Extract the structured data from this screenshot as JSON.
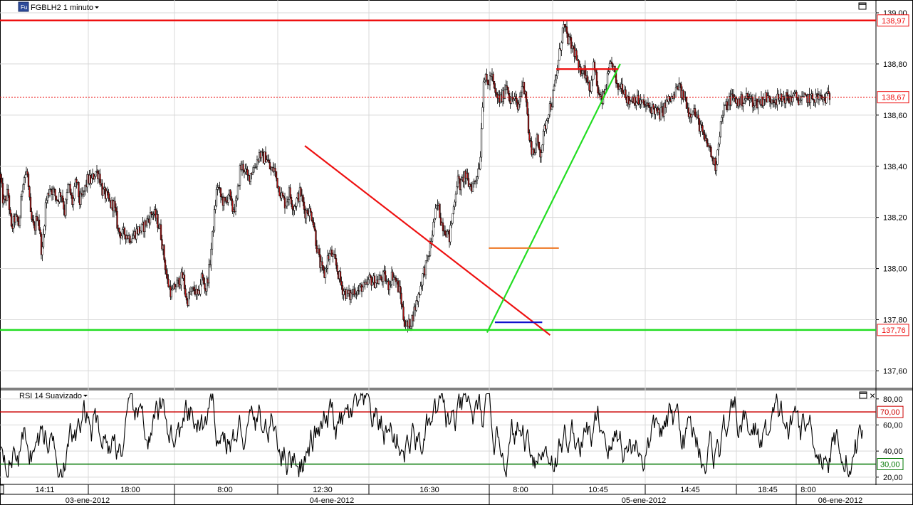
{
  "header": {
    "instrument_badge": "Fu",
    "title": "FGBLH2 1 minuto"
  },
  "rsi_panel": {
    "title": "RSI 14 Suavizado",
    "close_glyph": "×"
  },
  "colors": {
    "resistance": "#ee1111",
    "support": "#22dd22",
    "orange": "#ee7722",
    "blue": "#1111cc",
    "grid": "#d8d8d8",
    "candle_up": "#ffffff",
    "candle_down": "#aa1111",
    "rsi_upper": "#cc0000",
    "rsi_lower": "#007700"
  },
  "chart_data": [
    {
      "type": "candlestick",
      "title": "FGBLH2 1 minuto",
      "ylim": [
        137.54,
        139.0
      ],
      "y_ticks": [
        "137,60",
        "137,80",
        "138,00",
        "138,20",
        "138,40",
        "138,60",
        "138,80",
        "139,00"
      ],
      "y_tick_values": [
        137.6,
        137.8,
        138.0,
        138.2,
        138.4,
        138.6,
        138.8,
        139.0
      ],
      "time_ticks": [
        "14:11",
        "18:00",
        "8:00",
        "12:30",
        "16:30",
        "8:00",
        "10:45",
        "14:45",
        "18:45",
        "8:00"
      ],
      "date_labels": [
        "03-ene-2012",
        "04-ene-2012",
        "05-ene-2012",
        "06-ene-2012"
      ],
      "price_labels": [
        {
          "text": "138,97",
          "value": 138.97,
          "color": "resistance"
        },
        {
          "text": "138,67",
          "value": 138.67,
          "color": "resistance"
        },
        {
          "text": "137,76",
          "value": 137.76,
          "color": "resistance"
        }
      ],
      "horizontal_lines": [
        {
          "name": "resistance",
          "value": 138.97,
          "style": "solid",
          "color": "resistance"
        },
        {
          "name": "last-price",
          "value": 138.67,
          "style": "dotted",
          "color": "resistance"
        },
        {
          "name": "support",
          "value": 137.76,
          "style": "solid",
          "color": "support"
        }
      ],
      "anchors_x": [
        0,
        0.004,
        0.009,
        0.013,
        0.017,
        0.022,
        0.026,
        0.031,
        0.035,
        0.039,
        0.043,
        0.048,
        0.052,
        0.057,
        0.061,
        0.065,
        0.07,
        0.074,
        0.078,
        0.083,
        0.087,
        0.091,
        0.096,
        0.1,
        0.104,
        0.109,
        0.113,
        0.117,
        0.122,
        0.126,
        0.13,
        0.135,
        0.139,
        0.143,
        0.148,
        0.152,
        0.157,
        0.161,
        0.165,
        0.17,
        0.174,
        0.178,
        0.183,
        0.187,
        0.191,
        0.196,
        0.2,
        0.204,
        0.209,
        0.213,
        0.217,
        0.222,
        0.226,
        0.23,
        0.235,
        0.239,
        0.243,
        0.248,
        0.252,
        0.257,
        0.261,
        0.265,
        0.27,
        0.274,
        0.278,
        0.283,
        0.287,
        0.291,
        0.296,
        0.3,
        0.304,
        0.309,
        0.313,
        0.317,
        0.322,
        0.326,
        0.33,
        0.335,
        0.339,
        0.343,
        0.348,
        0.352,
        0.357,
        0.361,
        0.365,
        0.37,
        0.374,
        0.378,
        0.383,
        0.387,
        0.391,
        0.396,
        0.4,
        0.404,
        0.409,
        0.413,
        0.417,
        0.422,
        0.426,
        0.43,
        0.435,
        0.439,
        0.443,
        0.448,
        0.452,
        0.457,
        0.461,
        0.465,
        0.47,
        0.474,
        0.478,
        0.483,
        0.487,
        0.491,
        0.496,
        0.5,
        0.504,
        0.509,
        0.513,
        0.517,
        0.522,
        0.526,
        0.53,
        0.535,
        0.539,
        0.543,
        0.548,
        0.552,
        0.557,
        0.561,
        0.565,
        0.57,
        0.574,
        0.578,
        0.583,
        0.587,
        0.591,
        0.596,
        0.6,
        0.604,
        0.609,
        0.613,
        0.617,
        0.622,
        0.626,
        0.63,
        0.635,
        0.639,
        0.643,
        0.648,
        0.652,
        0.657,
        0.661,
        0.665,
        0.67,
        0.674,
        0.678,
        0.683,
        0.687,
        0.691,
        0.696,
        0.7,
        0.704,
        0.709,
        0.713,
        0.717,
        0.722,
        0.726,
        0.73,
        0.735,
        0.739,
        0.743,
        0.748,
        0.752,
        0.757,
        0.761,
        0.765,
        0.77,
        0.774,
        0.778,
        0.783,
        0.787,
        0.791,
        0.796,
        0.8,
        0.804,
        0.809,
        0.813,
        0.817,
        0.822,
        0.826,
        0.83,
        0.835,
        0.839,
        0.843,
        0.848,
        0.852,
        0.857,
        0.861,
        0.865,
        0.87,
        0.874,
        0.878,
        0.883,
        0.887,
        0.891,
        0.896,
        0.9,
        0.904,
        0.909,
        0.913,
        0.917,
        0.922,
        0.926,
        0.93,
        0.935,
        0.939,
        0.943,
        0.948,
        0.952,
        0.957,
        0.961,
        0.965,
        0.97,
        0.974,
        0.978,
        0.983,
        0.987,
        0.991,
        0.996,
        1.0
      ],
      "anchors_y": [
        138.37,
        138.25,
        138.3,
        138.15,
        138.2,
        138.17,
        138.35,
        138.38,
        138.2,
        138.15,
        138.22,
        138.05,
        138.25,
        138.32,
        138.3,
        138.27,
        138.3,
        138.22,
        138.33,
        138.25,
        138.35,
        138.26,
        138.3,
        138.35,
        138.34,
        138.38,
        138.37,
        138.3,
        138.28,
        138.25,
        138.25,
        138.15,
        138.13,
        138.14,
        138.12,
        138.13,
        138.15,
        138.15,
        138.17,
        138.2,
        138.22,
        138.2,
        138.15,
        138.05,
        137.95,
        137.9,
        137.93,
        137.95,
        137.97,
        137.87,
        137.9,
        137.92,
        137.88,
        137.97,
        137.92,
        138.0,
        138.15,
        138.33,
        138.28,
        138.25,
        138.3,
        138.23,
        138.25,
        138.39,
        138.4,
        138.35,
        138.38,
        138.4,
        138.45,
        138.43,
        138.44,
        138.38,
        138.39,
        138.33,
        138.28,
        138.25,
        138.3,
        138.24,
        138.27,
        138.3,
        138.22,
        138.23,
        138.2,
        138.1,
        138.02,
        137.97,
        138.04,
        138.06,
        138.02,
        137.97,
        137.92,
        137.9,
        137.89,
        137.92,
        137.91,
        137.93,
        137.92,
        137.96,
        137.95,
        137.95,
        137.96,
        137.97,
        137.93,
        137.98,
        137.95,
        137.9,
        137.8,
        137.77,
        137.8,
        137.85,
        137.9,
        137.98,
        138.02,
        138.08,
        138.2,
        138.25,
        138.18,
        138.15,
        138.12,
        138.22,
        138.35,
        138.32,
        138.37,
        138.33,
        138.32,
        138.35,
        138.42,
        138.75,
        138.72,
        138.76,
        138.68,
        138.66,
        138.67,
        138.73,
        138.65,
        138.67,
        138.62,
        138.72,
        138.7,
        138.5,
        138.45,
        138.5,
        138.45,
        138.55,
        138.62,
        138.65,
        138.75,
        138.85,
        138.95,
        138.9,
        138.87,
        138.84,
        138.76,
        138.79,
        138.75,
        138.7,
        138.8,
        138.68,
        138.65,
        138.7,
        138.78,
        138.8,
        138.7,
        138.72,
        138.7,
        138.65,
        138.67,
        138.66,
        138.65,
        138.64,
        138.63,
        138.63,
        138.62,
        138.6,
        138.62,
        138.65,
        138.66,
        138.67,
        138.72,
        138.68,
        138.66,
        138.6,
        138.63,
        138.58,
        138.55,
        138.5,
        138.48,
        138.43,
        138.4,
        138.55,
        138.62,
        138.64,
        138.67,
        138.66,
        138.65,
        138.66,
        138.67,
        138.66,
        138.65,
        138.65,
        138.66,
        138.67,
        138.66,
        138.67,
        138.66,
        138.66,
        138.67,
        138.66,
        138.67,
        138.67,
        138.66,
        138.66,
        138.67,
        138.66,
        138.67,
        138.67,
        138.66,
        138.67,
        138.67
      ],
      "series_note_visible_length_fraction": 0.943,
      "trendlines": [
        {
          "name": "red-downtrend",
          "x1": 0.348,
          "y1": 138.48,
          "x2": 0.628,
          "y2": 137.74,
          "color": "resistance"
        },
        {
          "name": "green-uptrend",
          "x1": 0.556,
          "y1": 137.75,
          "x2": 0.708,
          "y2": 138.8,
          "color": "support"
        },
        {
          "name": "red-top-segment",
          "x1": 0.635,
          "y1": 138.78,
          "x2": 0.706,
          "y2": 138.78,
          "color": "resistance"
        },
        {
          "name": "orange-segment",
          "x1": 0.558,
          "y1": 138.08,
          "x2": 0.638,
          "y2": 138.08,
          "color": "orange"
        },
        {
          "name": "blue-segment",
          "x1": 0.565,
          "y1": 137.79,
          "x2": 0.619,
          "y2": 137.79,
          "color": "blue"
        }
      ]
    },
    {
      "type": "line",
      "title": "RSI 14 Suavizado",
      "ylim": [
        15,
        87
      ],
      "y_ticks": [
        "20,00",
        "40,00",
        "60,00",
        "80,00"
      ],
      "y_tick_values": [
        20,
        40,
        60,
        80
      ],
      "levels": [
        {
          "text": "70,00",
          "value": 70,
          "color": "rsi_upper"
        },
        {
          "text": "30,00",
          "value": 30,
          "color": "rsi_lower"
        }
      ]
    }
  ]
}
